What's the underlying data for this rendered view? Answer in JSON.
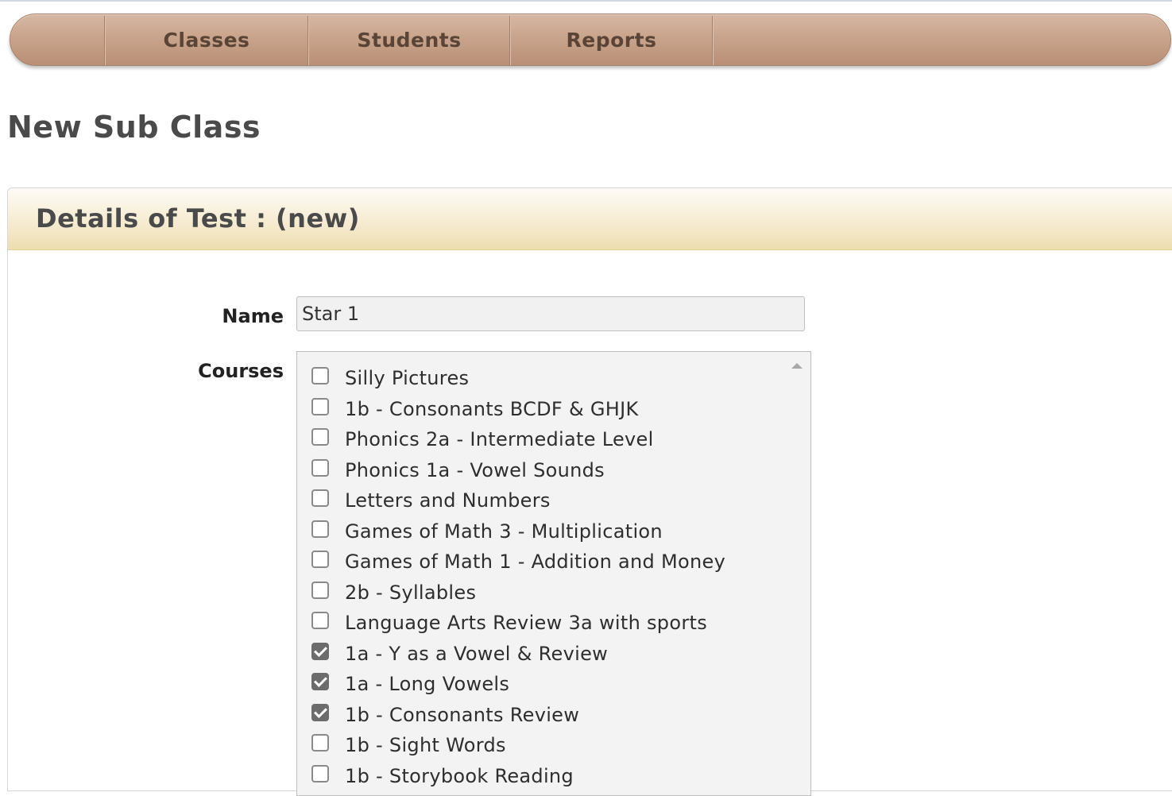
{
  "nav": {
    "items": [
      {
        "label": "Classes"
      },
      {
        "label": "Students"
      },
      {
        "label": "Reports"
      }
    ]
  },
  "page": {
    "title": "New Sub Class"
  },
  "panel": {
    "title": "Details of Test : (new)"
  },
  "form": {
    "name_label": "Name",
    "name_value": "Star 1",
    "courses_label": "Courses",
    "courses": [
      {
        "label": "Silly Pictures",
        "checked": false
      },
      {
        "label": "1b - Consonants BCDF & GHJK",
        "checked": false
      },
      {
        "label": "Phonics 2a - Intermediate Level",
        "checked": false
      },
      {
        "label": "Phonics 1a - Vowel Sounds",
        "checked": false
      },
      {
        "label": "Letters and Numbers",
        "checked": false
      },
      {
        "label": "Games of Math 3 - Multiplication",
        "checked": false
      },
      {
        "label": "Games of Math 1 - Addition and Money",
        "checked": false
      },
      {
        "label": "2b - Syllables",
        "checked": false
      },
      {
        "label": "Language Arts Review 3a with sports",
        "checked": false
      },
      {
        "label": "1a - Y as a Vowel & Review",
        "checked": true
      },
      {
        "label": "1a - Long Vowels",
        "checked": true
      },
      {
        "label": "1b - Consonants Review",
        "checked": true
      },
      {
        "label": "1b - Sight Words",
        "checked": false
      },
      {
        "label": "1b - Storybook Reading",
        "checked": false
      }
    ]
  },
  "colors": {
    "nav_bg": "#c9a48c",
    "nav_text": "#5a4435",
    "panel_header_bg": "#f6ecd2",
    "checkbox_checked": "#6c6c6c"
  },
  "icons": {
    "checked": "check-icon",
    "scroll_up": "scroll-up-arrow-icon"
  }
}
